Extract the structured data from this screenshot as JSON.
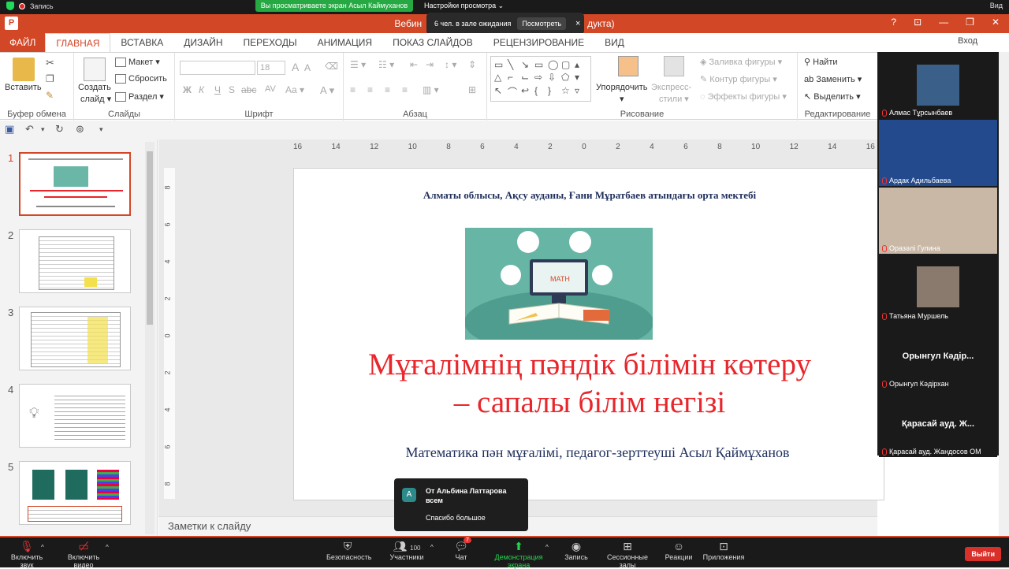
{
  "zoom_top": {
    "recording_label": "Запись",
    "share_banner": "Вы просматриваете экран Асыл Каймуханов",
    "view_options": "Настройки просмотра",
    "view_label": "Вид"
  },
  "waiting_room": {
    "text": "6 чел. в зале ожидания",
    "view_button": "Посмотреть"
  },
  "title_bar": {
    "title_left": "Вебин",
    "title_right": "дукта)"
  },
  "ribbon_tabs": [
    "ФАЙЛ",
    "ГЛАВНАЯ",
    "ВСТАВКА",
    "ДИЗАЙН",
    "ПЕРЕХОДЫ",
    "АНИМАЦИЯ",
    "ПОКАЗ СЛАЙДОВ",
    "РЕЦЕНЗИРОВАНИЕ",
    "ВИД"
  ],
  "signin": "Вход",
  "ribbon": {
    "clipboard": {
      "paste": "Вставить",
      "label": "Буфер обмена"
    },
    "slides": {
      "new_slide_1": "Создать",
      "new_slide_2": "слайд",
      "layout": "Макет",
      "reset": "Сбросить",
      "section": "Раздел",
      "label": "Слайды"
    },
    "font": {
      "size": "18",
      "label": "Шрифт"
    },
    "paragraph": {
      "label": "Абзац"
    },
    "drawing": {
      "arrange": "Упорядочить",
      "quick_styles_1": "Экспресс-",
      "quick_styles_2": "стили",
      "fill": "Заливка фигуры",
      "outline": "Контур фигуры",
      "effects": "Эффекты фигуры",
      "label": "Рисование"
    },
    "editing": {
      "find": "Найти",
      "replace": "Заменить",
      "select": "Выделить",
      "label": "Редактирование"
    }
  },
  "ruler_h": [
    "16",
    "14",
    "12",
    "10",
    "8",
    "6",
    "4",
    "2",
    "0",
    "2",
    "4",
    "6",
    "8",
    "10",
    "12",
    "14",
    "16"
  ],
  "ruler_v": [
    "8",
    "6",
    "4",
    "2",
    "0",
    "2",
    "4",
    "6",
    "8"
  ],
  "thumbnails": [
    "1",
    "2",
    "3",
    "4",
    "5"
  ],
  "slide": {
    "school": "Алматы облысы, Ақсу ауданы, Ғани Мұратбаев атындағы орта мектебі",
    "title_line1": "Мұғалімнің пәндік білімін көтеру",
    "title_line2": "– сапалы білім негізі",
    "subtitle": "Математика пән мұғалімі, педагог-зерттеуші Асыл Қаймұханов"
  },
  "notes_label": "Заметки к слайду",
  "participants": [
    "Алмас Тұрсынбаев",
    "Ардак Адильбаева",
    "Оразәлі Гулина",
    "Татьяна Муршель",
    "Орынгул Кәдірхан",
    "Қарасай ауд. Жандосов ОМ"
  ],
  "participant_center_names": [
    "Орынгул Кәдір...",
    "Қарасай ауд. Ж..."
  ],
  "chat_toast": {
    "avatar": "A",
    "from": "От Альбина Латтарова всем",
    "message": "Спасибо большое"
  },
  "zoom_bar": {
    "mute": "Включить звук",
    "video": "Включить видео",
    "security": "Безопасность",
    "participants": "Участники",
    "participants_count": "100",
    "chat": "Чат",
    "chat_badge": "7",
    "share": "Демонстрация экрана",
    "record": "Запись",
    "breakout": "Сессионные залы",
    "reactions": "Реакции",
    "apps": "Приложения",
    "leave": "Выйти"
  },
  "colors": {
    "ppt_brand": "#d24726",
    "slide_title": "#e8262b",
    "slide_navy": "#1f2f5c",
    "zoom_green": "#26a843"
  }
}
